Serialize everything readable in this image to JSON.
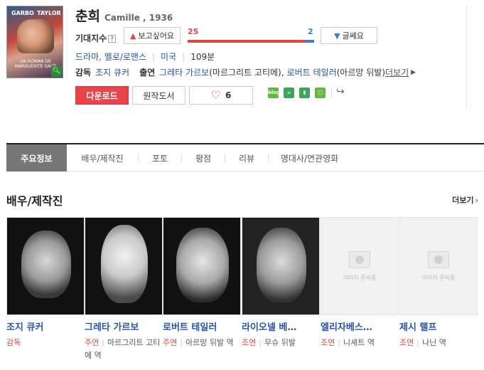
{
  "movie": {
    "title_ko": "춘희",
    "title_en": "Camille , 1936",
    "poster": {
      "top_left": "GARBO",
      "top_right": "TAYLOR",
      "bottom_text": "UN ROMAN DE MARGUERITE GAUT"
    }
  },
  "expectation": {
    "label": "기대지수",
    "help": "?",
    "want_label": "보고싶어요",
    "want_count": "25",
    "meh_label": "글쎄요",
    "meh_count": "2",
    "want_ratio": 0.93
  },
  "meta": {
    "genre": "드라마, 멜로/로맨스",
    "country": "미국",
    "runtime": "109분"
  },
  "credits": {
    "director_label": "감독",
    "director": "조지 큐커",
    "cast_label": "출연",
    "cast1": "그레타 가르보",
    "cast1_role": "(마르그리트 고티에)",
    "comma": ",",
    "cast2": "로버트 테일러",
    "cast2_role": "(아르망 뒤발)",
    "more": "더보기"
  },
  "actions": {
    "download": "다운로드",
    "original_book": "원작도서",
    "like_count": "6"
  },
  "share": [
    {
      "name": "blog",
      "label": "blog",
      "color": "#5fb83b"
    },
    {
      "name": "cafe",
      "label": "☕",
      "color": "#3aa657"
    },
    {
      "name": "bookmark",
      "label": "▮",
      "color": "#3aa657"
    },
    {
      "name": "memo",
      "label": "□",
      "color": "#6bb540"
    }
  ],
  "tabs": [
    "주요정보",
    "배우/제작진",
    "포토",
    "평점",
    "리뷰",
    "명대사/연관영화"
  ],
  "section": {
    "title": "배우/제작진",
    "more": "더보기"
  },
  "cast": [
    {
      "name": "조지 큐커",
      "role": "감독",
      "character": "",
      "has_photo": true
    },
    {
      "name": "그레타 가르보",
      "role": "주연",
      "character": "마르그리트 고티에 역",
      "has_photo": true
    },
    {
      "name": "로버트 테일러",
      "role": "주연",
      "character": "아르망 뒤발 역",
      "has_photo": true
    },
    {
      "name": "라이오넬 베…",
      "role": "조연",
      "character": "무슈 뒤발",
      "has_photo": true
    },
    {
      "name": "엘리자베스…",
      "role": "조연",
      "character": "니셰트 역",
      "has_photo": false
    },
    {
      "name": "제시 랠프",
      "role": "조연",
      "character": "나닌 역",
      "has_photo": false
    }
  ],
  "no_image_text": "이미지 준비중",
  "colors": {
    "accent_red": "#e04545",
    "link_blue": "#2a52a8",
    "active_tab": "#777777"
  }
}
